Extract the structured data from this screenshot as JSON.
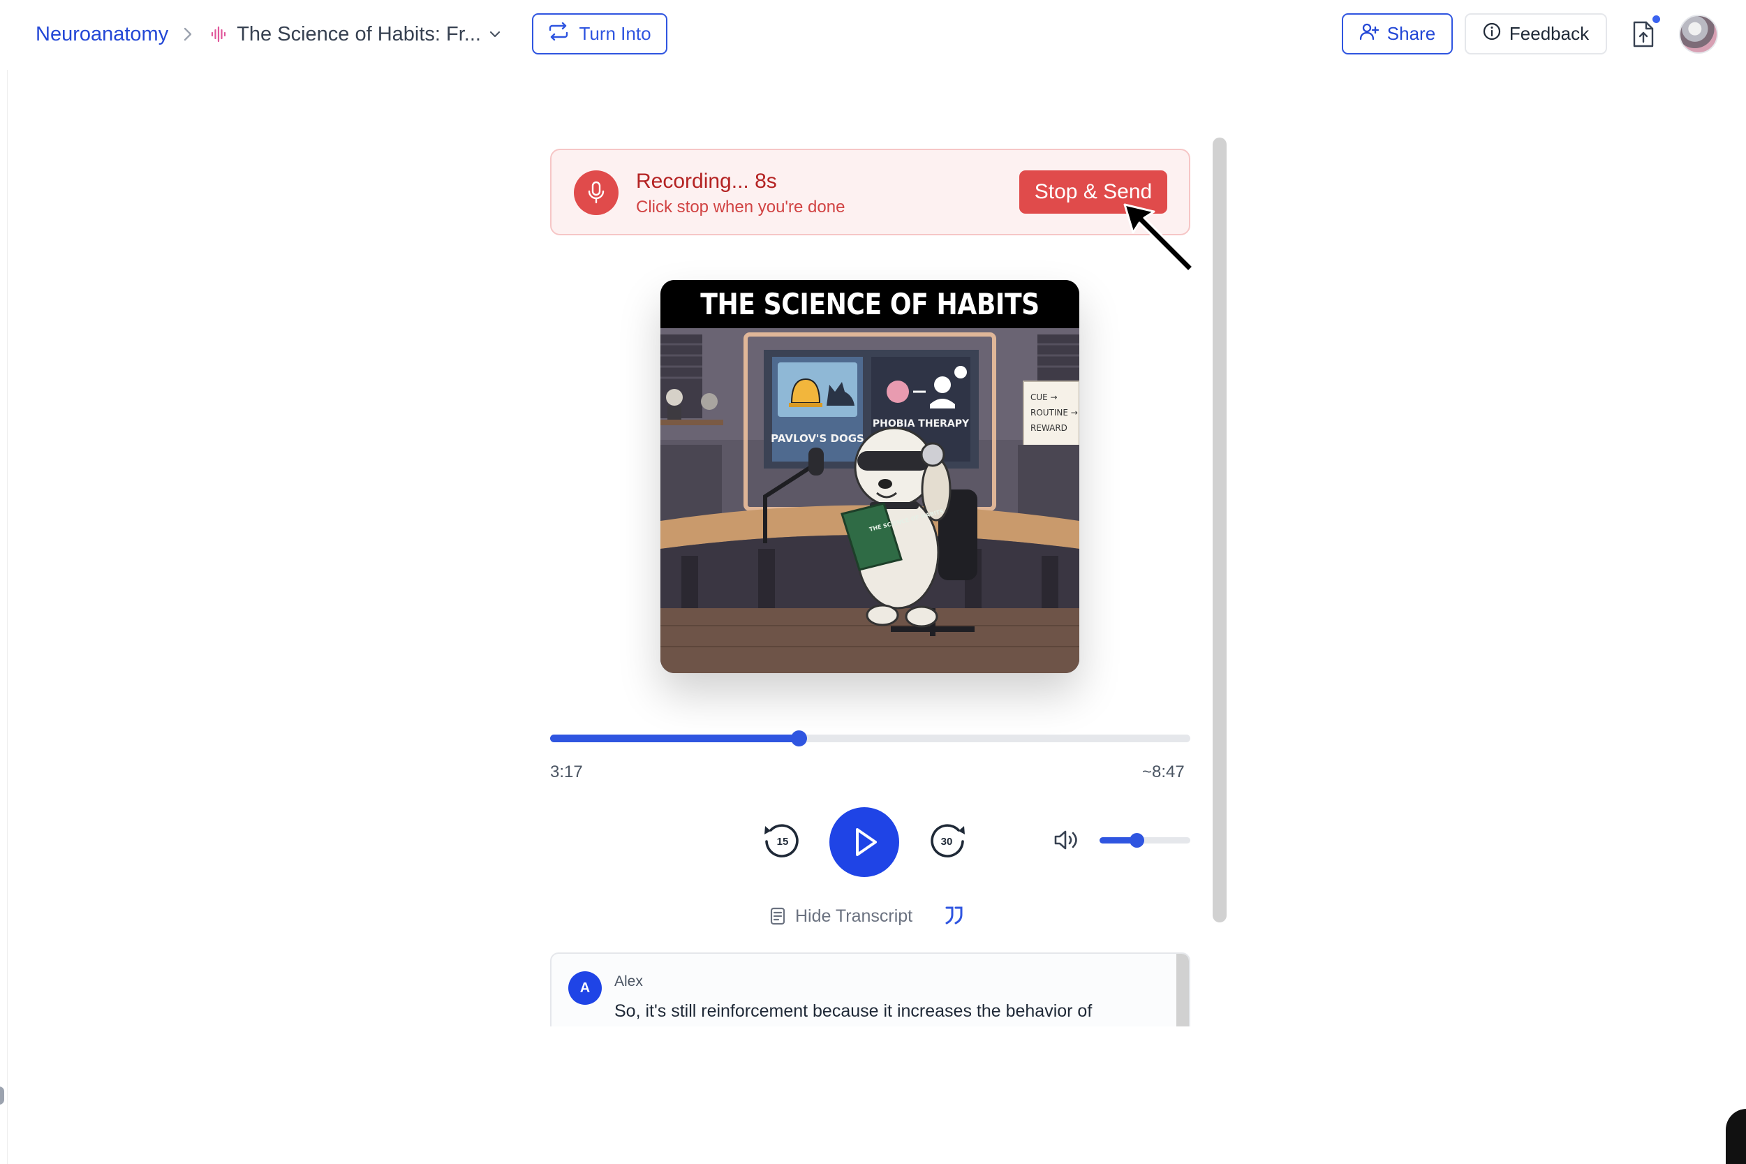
{
  "header": {
    "breadcrumb_root": "Neuroanatomy",
    "current_title": "The Science of Habits: Fr...",
    "turn_into_label": "Turn Into",
    "share_label": "Share",
    "feedback_label": "Feedback",
    "icons": {
      "breadcrumb_separator": "chevron-right-icon",
      "audio": "audio-waveform-icon",
      "title_menu": "chevron-down-icon",
      "turn_into": "repeat-icon",
      "share": "add-user-icon",
      "feedback": "info-icon",
      "export": "file-upload-icon"
    },
    "export_has_notification": true
  },
  "recording": {
    "status": "Recording... 8s",
    "hint": "Click stop when you're done",
    "stop_label": "Stop & Send",
    "mic_icon": "microphone-icon"
  },
  "cover": {
    "title": "THE SCIENCE OF HABITS",
    "panel_left": "PAVLOV'S DOGS",
    "panel_right": "PHOBIA THERAPY",
    "sign_lines": [
      "CUE →",
      "ROUTINE →",
      "REWARD"
    ],
    "book_title": "THE SCIENCE OF HABITS"
  },
  "player": {
    "current_time": "3:17",
    "total_time": "~8:47",
    "progress_fraction": 0.388,
    "skip_back_seconds": "15",
    "skip_forward_seconds": "30",
    "volume_fraction": 0.41,
    "play_icon": "play-icon",
    "volume_icon": "volume-icon"
  },
  "transcript": {
    "toggle_label": "Hide Transcript",
    "toggle_icon": "document-icon",
    "quote_icon": "quote-icon",
    "entries": [
      {
        "initial": "A",
        "speaker": "Alex",
        "text": "So, it's still reinforcement because it increases the behavior of"
      }
    ]
  },
  "colors": {
    "accent": "#2f55e0",
    "play_button": "#1f44e6",
    "recording_red": "#e04b4b",
    "recording_bg": "#fdf1f1"
  }
}
